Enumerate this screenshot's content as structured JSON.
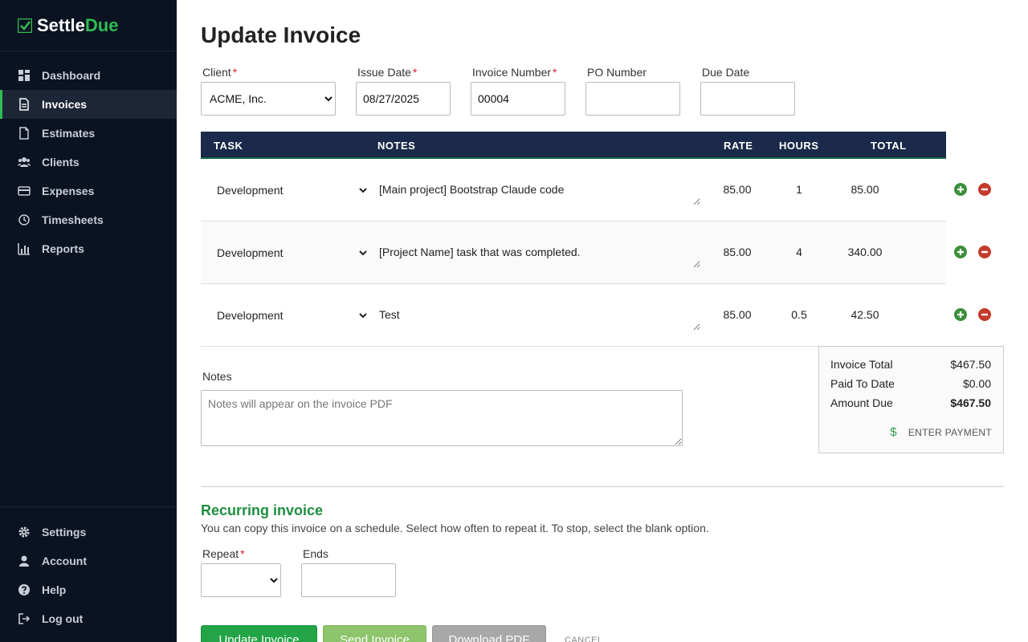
{
  "app": {
    "brand_part1": "Settle",
    "brand_part2": "Due",
    "brand_color": "#2fbd52",
    "sidebar_bg": "#0b1322"
  },
  "sidebar": {
    "items": [
      {
        "label": "Dashboard",
        "icon": "dashboard-icon"
      },
      {
        "label": "Invoices",
        "icon": "document-icon",
        "active": true
      },
      {
        "label": "Estimates",
        "icon": "file-icon"
      },
      {
        "label": "Clients",
        "icon": "users-icon"
      },
      {
        "label": "Expenses",
        "icon": "credit-card-icon"
      },
      {
        "label": "Timesheets",
        "icon": "clock-icon"
      },
      {
        "label": "Reports",
        "icon": "bar-chart-icon"
      }
    ],
    "bottom_items": [
      {
        "label": "Settings",
        "icon": "gear-icon"
      },
      {
        "label": "Account",
        "icon": "user-icon"
      },
      {
        "label": "Help",
        "icon": "question-icon"
      },
      {
        "label": "Log out",
        "icon": "logout-icon"
      }
    ]
  },
  "page": {
    "title": "Update Invoice"
  },
  "form": {
    "client_label": "Client",
    "client_value": "ACME, Inc.",
    "issue_date_label": "Issue Date",
    "issue_date_value": "08/27/2025",
    "invoice_number_label": "Invoice Number",
    "invoice_number_value": "00004",
    "po_number_label": "PO Number",
    "po_number_value": "",
    "due_date_label": "Due Date",
    "due_date_value": ""
  },
  "table": {
    "headers": [
      "TASK",
      "NOTES",
      "RATE",
      "HOURS",
      "TOTAL"
    ],
    "rows": [
      {
        "task": "Development",
        "note": "[Main project] Bootstrap Claude code",
        "rate": "85.00",
        "hours": "1",
        "total": "85.00"
      },
      {
        "task": "Development",
        "note": "[Project Name] task that was completed.",
        "rate": "85.00",
        "hours": "4",
        "total": "340.00"
      },
      {
        "task": "Development",
        "note": "Test",
        "rate": "85.00",
        "hours": "0.5",
        "total": "42.50"
      }
    ]
  },
  "notes": {
    "label": "Notes",
    "placeholder": "Notes will appear on the invoice PDF"
  },
  "totals": {
    "invoice_total_label": "Invoice Total",
    "invoice_total_value": "$467.50",
    "paid_label": "Paid To Date",
    "paid_value": "$0.00",
    "due_label": "Amount Due",
    "due_value": "$467.50",
    "payment_icon": "$",
    "payment_label": "ENTER PAYMENT"
  },
  "recurring": {
    "title": "Recurring invoice",
    "description": "You can copy this invoice on a schedule. Select how often to repeat it. To stop, select the blank option.",
    "repeat_label": "Repeat",
    "repeat_value": "",
    "ends_label": "Ends",
    "ends_value": ""
  },
  "actions": {
    "update_label": "Update Invoice",
    "send_label": "Send Invoice",
    "download_label": "Download PDF",
    "cancel_label": "CANCEL"
  }
}
